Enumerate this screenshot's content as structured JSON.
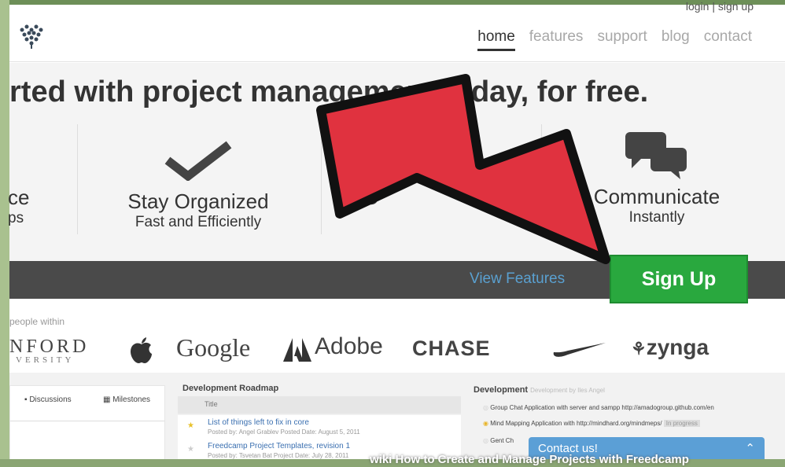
{
  "top": {
    "login_links": "login | sign up"
  },
  "nav": {
    "home": "home",
    "features": "features",
    "support": "support",
    "blog": "blog",
    "contact": "contact"
  },
  "hero": {
    "headline": "rted with project management today, for free.",
    "features": [
      {
        "title": "ce",
        "subtitle": "ps"
      },
      {
        "title": "Stay Organized",
        "subtitle": "Fast and Efficiently"
      },
      {
        "title": "C",
        "subtitle": ""
      },
      {
        "title": "Communicate",
        "subtitle": "Instantly"
      }
    ]
  },
  "cta": {
    "view_features": "View Features",
    "sign_up": "Sign Up"
  },
  "logos": {
    "intro": "people within",
    "items": [
      "NFORD",
      "VERSITY",
      "Google",
      "Adobe",
      "CHASE",
      "zynga"
    ]
  },
  "app_preview": {
    "tabs": [
      "Discussions",
      "Milestones"
    ],
    "roadmap": {
      "title": "Development Roadmap",
      "col": "Title",
      "rows": [
        {
          "title": "List of things left to fix in core",
          "meta": "Posted by: Angel Grablev Posted Date: August 5, 2011"
        },
        {
          "title": "Freedcamp Project Templates, revision 1",
          "meta": "Posted by: Tsvetan Bat Project Date: July 28, 2011"
        }
      ]
    },
    "development": {
      "title": "Development",
      "subtitle": "Development by Iles Angel",
      "items": [
        "Group Chat Application with server and sampp http://amadogroup.github.com/en",
        "Mind Mapping Application with http://mindhard.org/mindmeps/",
        "Gent Ch"
      ],
      "tag": "In progress"
    }
  },
  "contact": {
    "label": "Contact us!"
  },
  "watermark": {
    "text": "wiki How to Create and Manage Projects with Freedcamp"
  },
  "colors": {
    "signup": "#29a83e",
    "arrow": "#e0323f",
    "darkbar": "#4a4a4a",
    "view_features": "#5aa0d0"
  }
}
